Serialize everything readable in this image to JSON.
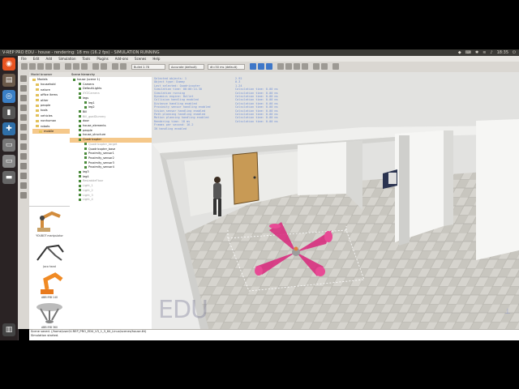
{
  "window": {
    "title": "V-REP PRO EDU - house - rendering: 18 ms (16.2 fps) - SIMULATION RUNNING",
    "clock": "18:35"
  },
  "menu": [
    "File",
    "Edit",
    "Add",
    "Simulation",
    "Tools",
    "Plugins",
    "Add-ons",
    "Scenes",
    "Help"
  ],
  "toolbar": {
    "engine": "Bullet 2.78",
    "accuracy": "Accurate (default)",
    "step": "dt=50 ms (default)"
  },
  "model_browser": {
    "header": "Model browser",
    "root": "Models",
    "folders": [
      "household",
      "nature",
      "office items",
      "other",
      "people",
      "tools",
      "vehicles",
      "nonhuman",
      "robots",
      "mobile"
    ],
    "thumbnails": [
      "YOUBOT manipulator",
      "Jaco hand",
      "ABB IRB 140",
      "ABB IRB 360"
    ]
  },
  "hierarchy": {
    "header": "Scene hierarchy",
    "rows": [
      {
        "label": "house (scene 1)",
        "depth": 0,
        "state": "normal"
      },
      {
        "label": "Camera",
        "depth": 1,
        "state": "normal"
      },
      {
        "label": "DefaultLights",
        "depth": 1,
        "state": "normal"
      },
      {
        "label": "XYZCamera",
        "depth": 1,
        "state": "dim"
      },
      {
        "label": "legs",
        "depth": 1,
        "state": "normal"
      },
      {
        "label": "leg1",
        "depth": 2,
        "state": "normal"
      },
      {
        "label": "leg2",
        "depth": 2,
        "state": "normal"
      },
      {
        "label": "Bill",
        "depth": 1,
        "state": "normal"
      },
      {
        "label": "Bill_goalDummy",
        "depth": 1,
        "state": "dim"
      },
      {
        "label": "door",
        "depth": 1,
        "state": "normal"
      },
      {
        "label": "house_elements",
        "depth": 1,
        "state": "normal"
      },
      {
        "label": "people",
        "depth": 1,
        "state": "normal"
      },
      {
        "label": "house_structure",
        "depth": 1,
        "state": "normal"
      },
      {
        "label": "Quadricopter",
        "depth": 1,
        "state": "selected"
      },
      {
        "label": "Quadricopter_target",
        "depth": 2,
        "state": "dim"
      },
      {
        "label": "Quadricopter_base",
        "depth": 2,
        "state": "normal"
      },
      {
        "label": "Proximity_sensor1",
        "depth": 2,
        "state": "normal"
      },
      {
        "label": "Proximity_sensor2",
        "depth": 2,
        "state": "normal"
      },
      {
        "label": "Proximity_sensor3",
        "depth": 2,
        "state": "normal"
      },
      {
        "label": "Proximity_sensor4",
        "depth": 2,
        "state": "normal"
      },
      {
        "label": "leg3",
        "depth": 1,
        "state": "normal"
      },
      {
        "label": "leg4",
        "depth": 1,
        "state": "normal"
      },
      {
        "label": "ResizableFloor",
        "depth": 1,
        "state": "dim"
      },
      {
        "label": "Light_1",
        "depth": 1,
        "state": "dim"
      },
      {
        "label": "Light_2",
        "depth": 1,
        "state": "dim"
      },
      {
        "label": "Light_3",
        "depth": 1,
        "state": "dim"
      },
      {
        "label": "Light_4",
        "depth": 1,
        "state": "dim"
      }
    ]
  },
  "info_overlay": {
    "col1": [
      "Selected objects: 1",
      "Object type: Dummy",
      "Last selected: Quadricopter",
      "Simulation time: 00:00:14.30",
      "Simulation running",
      "Dynamics engine: Bullet",
      "Collision handling enabled",
      "Distance handling enabled",
      "Proximity sensor handling enabled",
      "Vision sensor handling enabled",
      "Path planning handling enabled",
      "Motion planning handling enabled",
      "Rendering time: 18 ms",
      "Frames per second: 16.2",
      "IK handling enabled"
    ],
    "col2": [
      "2.92",
      "0.3",
      "1.24",
      "Calculation time: 0.00 ms",
      "Calculation time: 0.00 ms",
      "Calculation time: 0.00 ms",
      "Calculation time: 0.00 ms",
      "Calculation time: 0.00 ms",
      "Calculation time: 0.00 ms",
      "Calculation time: 0.00 ms",
      "Calculation time: 0.00 ms",
      "Calculation time: 0.00 ms",
      "Calculation time: 0.00 ms"
    ],
    "watermark": "EDU"
  },
  "status_bar": {
    "line1": "Scene saved. (/home/user/V-REP_PRO_EDU_V3_1_3_64_Linux/scenes/house.ttt)",
    "line2": "Simulation started."
  },
  "colors": {
    "selection": "#f5c88a",
    "drone": "#d8247a",
    "info_text": "#6f8fd6"
  }
}
